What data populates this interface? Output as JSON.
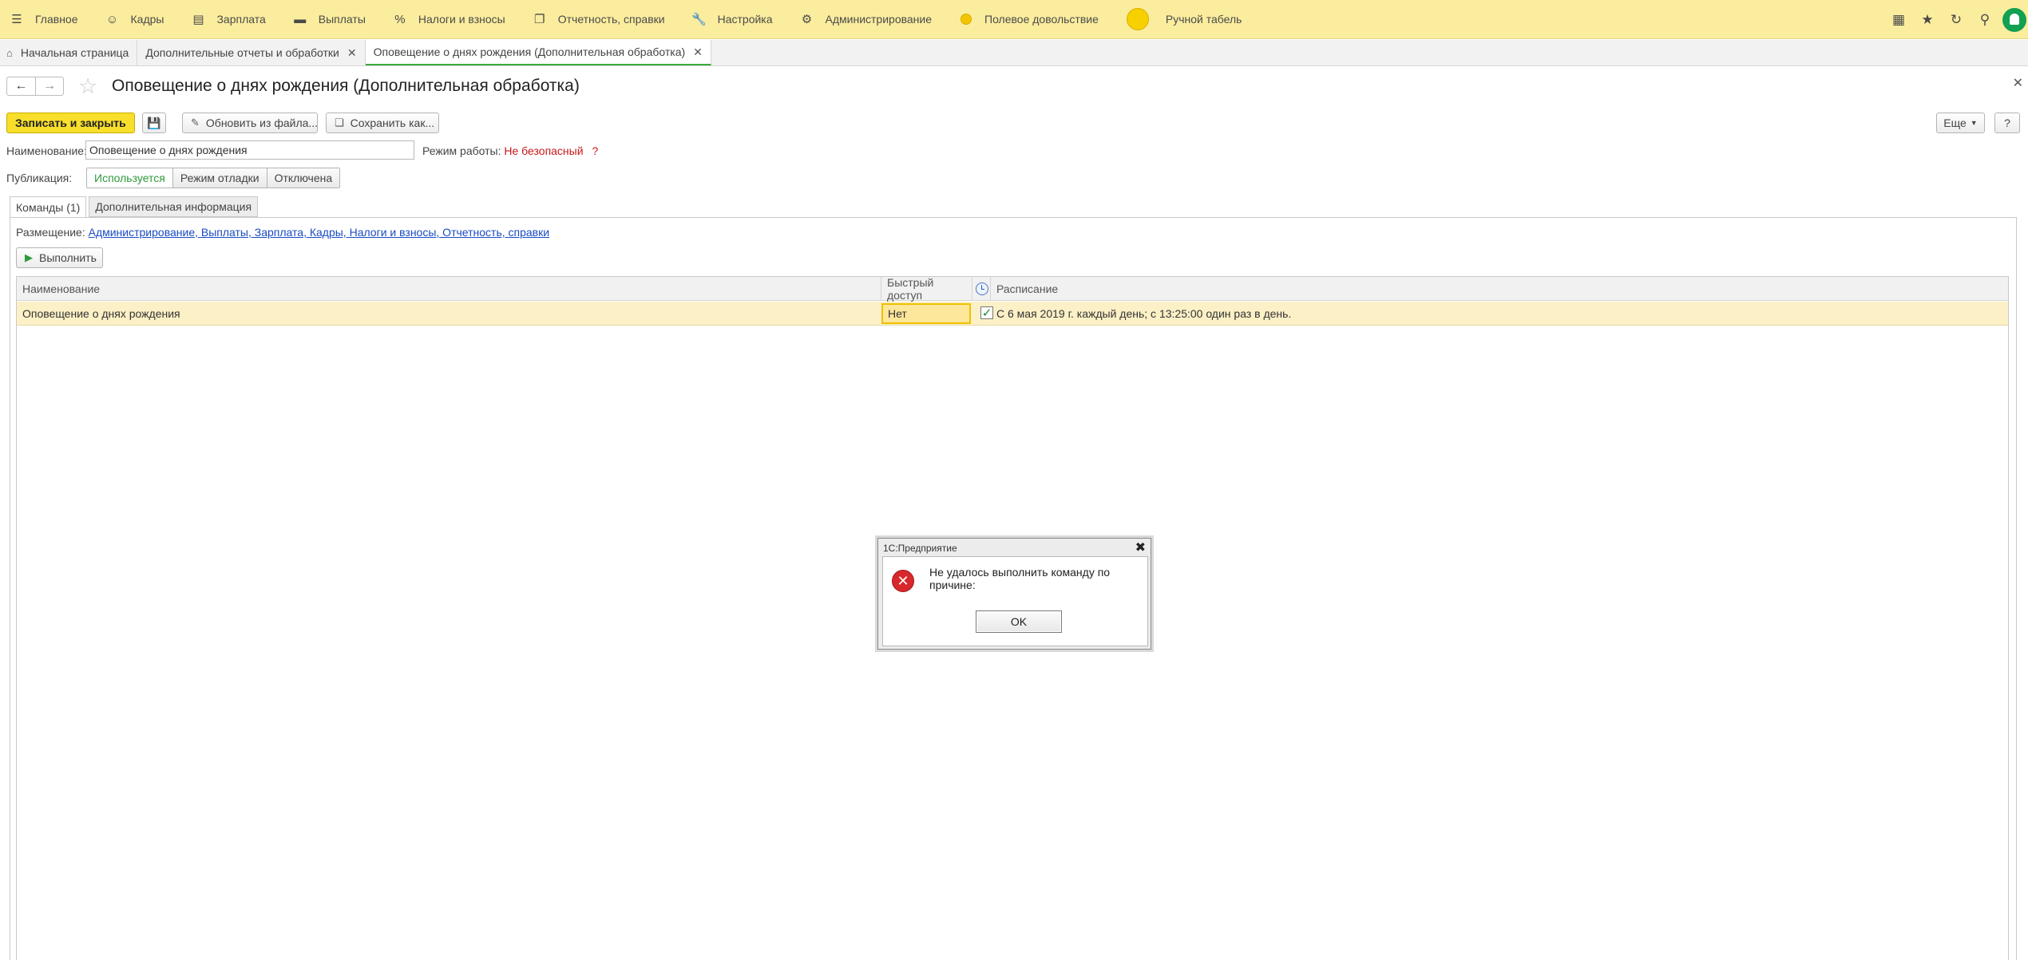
{
  "menu": {
    "items": [
      {
        "label": "Главное",
        "icon": "hamburger-icon"
      },
      {
        "label": "Кадры",
        "icon": "people-icon"
      },
      {
        "label": "Зарплата",
        "icon": "document-icon"
      },
      {
        "label": "Выплаты",
        "icon": "wallet-icon"
      },
      {
        "label": "Налоги и взносы",
        "icon": "percent-icon"
      },
      {
        "label": "Отчетность, справки",
        "icon": "reports-icon"
      },
      {
        "label": "Настройка",
        "icon": "wrench-icon"
      },
      {
        "label": "Администрирование",
        "icon": "gear-icon"
      },
      {
        "label": "Полевое довольствие",
        "icon": "sun-small-icon"
      },
      {
        "label": "Ручной табель",
        "icon": "sun-large-icon"
      }
    ]
  },
  "tabs": [
    {
      "label": "Начальная страница"
    },
    {
      "label": "Дополнительные отчеты и обработки"
    },
    {
      "label": "Оповещение о днях рождения (Дополнительная обработка)"
    }
  ],
  "page": {
    "title": "Оповещение о днях рождения (Дополнительная обработка)"
  },
  "toolbar": {
    "save_close": "Записать и закрыть",
    "update_from_file": "Обновить из файла...",
    "save_as": "Сохранить как...",
    "more": "Еще",
    "help": "?"
  },
  "form": {
    "name_label": "Наименование:",
    "name_value": "Оповещение о днях рождения",
    "mode_label": "Режим работы:",
    "mode_value": "Не безопасный",
    "mode_help": "?",
    "publication_label": "Публикация:",
    "publication_options": [
      "Используется",
      "Режим отладки",
      "Отключена"
    ],
    "publication_selected": "Используется"
  },
  "inner_tabs": [
    {
      "label": "Команды (1)"
    },
    {
      "label": "Дополнительная информация"
    }
  ],
  "commands": {
    "placement_label": "Размещение:",
    "placement_value": "Администрирование, Выплаты, Зарплата, Кадры, Налоги и взносы, Отчетность, справки",
    "run_button": "Выполнить",
    "columns": [
      "Наименование",
      "Быстрый доступ",
      "",
      "Расписание"
    ],
    "rows": [
      {
        "name": "Оповещение о днях рождения",
        "quick_access": "Нет",
        "scheduled": true,
        "schedule": "С 6 мая 2019 г. каждый день; с 13:25:00 один раз в день."
      }
    ]
  },
  "dialog": {
    "title": "1С:Предприятие",
    "message": "Не удалось выполнить команду по причине:",
    "detail": ".",
    "ok": "OK"
  },
  "colors": {
    "menu_bg": "#fbed9e",
    "primary_button": "#f8df2b",
    "accent_green": "#3bab3b",
    "error_red": "#c8171a",
    "row_highlight": "#fcf0c6",
    "link": "#1a4bc2"
  }
}
